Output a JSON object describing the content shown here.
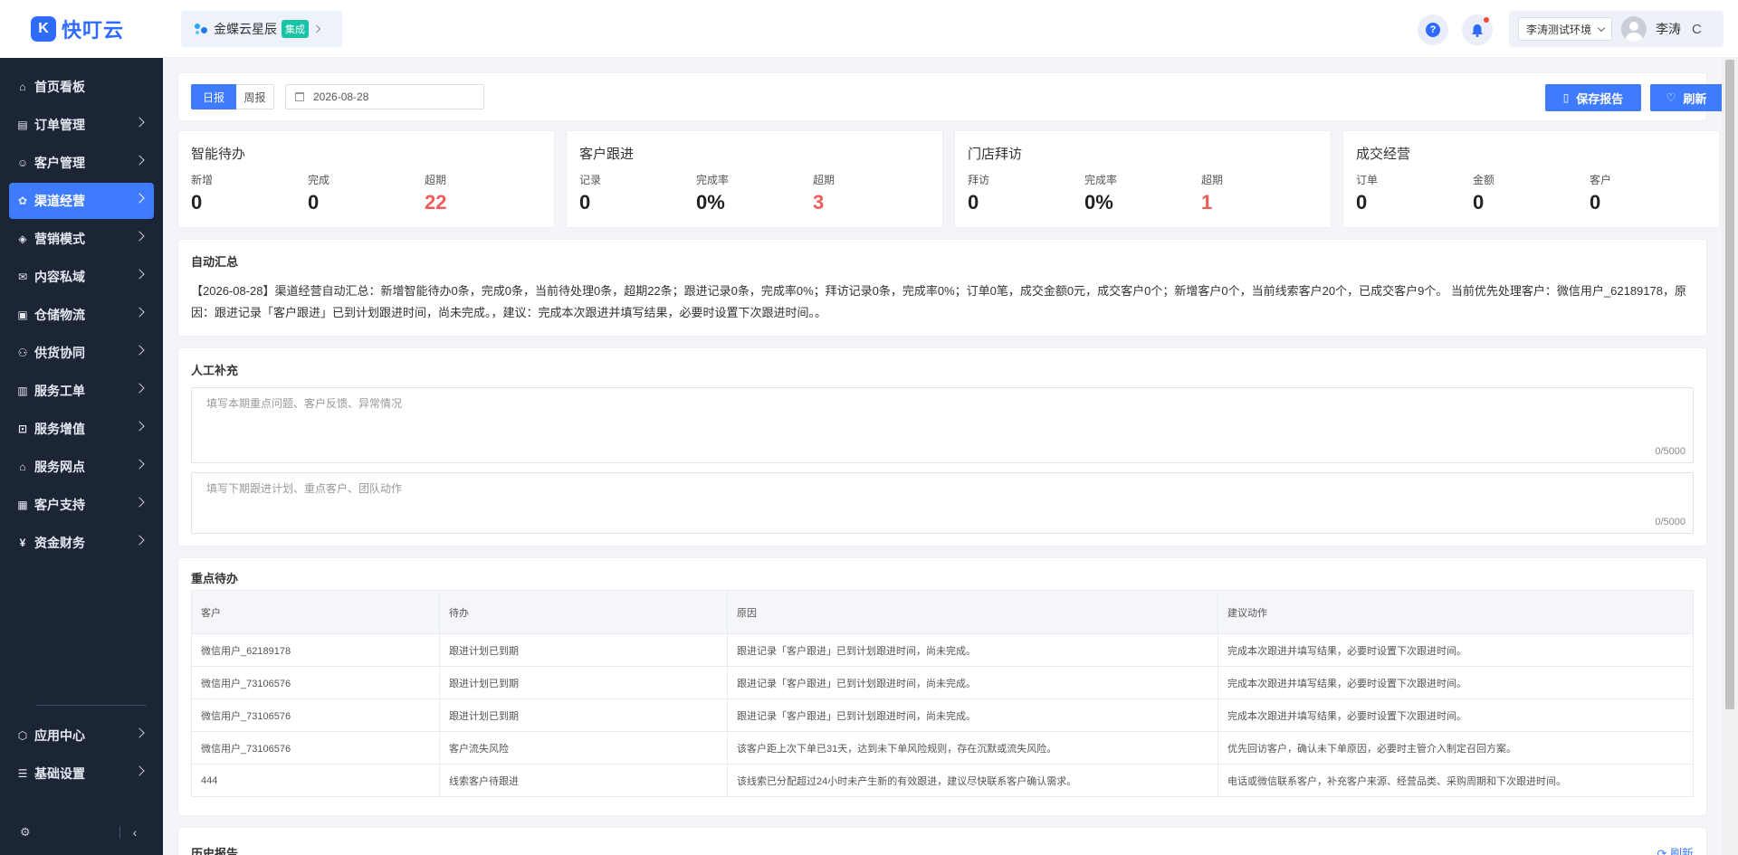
{
  "app": {
    "logo_text": "快叮云",
    "logo_mark": "K"
  },
  "sidebar": {
    "items": [
      {
        "label": "首页看板",
        "icon": "home-icon"
      },
      {
        "label": "订单管理",
        "icon": "order-icon"
      },
      {
        "label": "客户管理",
        "icon": "user-icon"
      },
      {
        "label": "渠道经营",
        "icon": "channel-icon"
      },
      {
        "label": "营销模式",
        "icon": "tag-icon"
      },
      {
        "label": "内容私域",
        "icon": "mail-icon"
      },
      {
        "label": "仓储物流",
        "icon": "box-icon"
      },
      {
        "label": "供货协同",
        "icon": "supply-icon"
      },
      {
        "label": "服务工单",
        "icon": "ticket-icon"
      },
      {
        "label": "服务增值",
        "icon": "bag-icon"
      },
      {
        "label": "服务网点",
        "icon": "store-icon"
      },
      {
        "label": "客户支持",
        "icon": "support-icon"
      },
      {
        "label": "资金财务",
        "icon": "yuan-icon"
      }
    ],
    "bottom_items": [
      {
        "label": "应用中心",
        "icon": "app-icon"
      },
      {
        "label": "基础设置",
        "icon": "settings-icon"
      }
    ]
  },
  "header": {
    "integration_name": "金蝶云星辰",
    "integration_badge": "集成",
    "help_glyph": "?",
    "env_label": "李涛测试环境",
    "user_name": "李涛",
    "refresh_glyph": "C"
  },
  "toolbar": {
    "tab_daily": "日报",
    "tab_weekly": "周报",
    "date_value": "2026-08-28",
    "save_label": "保存报告",
    "refresh_label": "刷新"
  },
  "stats": [
    {
      "title": "智能待办",
      "items": [
        {
          "label": "新增",
          "value": "0"
        },
        {
          "label": "完成",
          "value": "0"
        },
        {
          "label": "超期",
          "value": "22"
        }
      ]
    },
    {
      "title": "客户跟进",
      "items": [
        {
          "label": "记录",
          "value": "0"
        },
        {
          "label": "完成率",
          "value": "0%"
        },
        {
          "label": "超期",
          "value": "3"
        }
      ]
    },
    {
      "title": "门店拜访",
      "items": [
        {
          "label": "拜访",
          "value": "0"
        },
        {
          "label": "完成率",
          "value": "0%"
        },
        {
          "label": "超期",
          "value": "1"
        }
      ]
    },
    {
      "title": "成交经营",
      "items": [
        {
          "label": "订单",
          "value": "0"
        },
        {
          "label": "金额",
          "value": "0"
        },
        {
          "label": "客户",
          "value": "0"
        }
      ]
    }
  ],
  "summary": {
    "title": "自动汇总",
    "text": "【2026-08-28】渠道经营自动汇总：新增智能待办0条，完成0条，当前待处理0条，超期22条；跟进记录0条，完成率0%；拜访记录0条，完成率0%；订单0笔，成交金额0元，成交客户0个；新增客户0个，当前线索客户20个，已成交客户9个。 当前优先处理客户：微信用户_62189178，原因：跟进记录「客户跟进」已到计划跟进时间，尚未完成。，建议：完成本次跟进并填写结果，必要时设置下次跟进时间。。"
  },
  "manual": {
    "title": "人工补充",
    "field1_placeholder": "填写本期重点问题、客户反馈、异常情况",
    "field1_count": "0/5000",
    "field2_placeholder": "填写下期跟进计划、重点客户、团队动作",
    "field2_count": "0/5000"
  },
  "todo": {
    "title": "重点待办",
    "columns": [
      "客户",
      "待办",
      "原因",
      "建议动作"
    ],
    "rows": [
      [
        "微信用户_62189178",
        "跟进计划已到期",
        "跟进记录「客户跟进」已到计划跟进时间，尚未完成。",
        "完成本次跟进并填写结果，必要时设置下次跟进时间。"
      ],
      [
        "微信用户_73106576",
        "跟进计划已到期",
        "跟进记录「客户跟进」已到计划跟进时间，尚未完成。",
        "完成本次跟进并填写结果，必要时设置下次跟进时间。"
      ],
      [
        "微信用户_73106576",
        "跟进计划已到期",
        "跟进记录「客户跟进」已到计划跟进时间，尚未完成。",
        "完成本次跟进并填写结果，必要时设置下次跟进时间。"
      ],
      [
        "微信用户_73106576",
        "客户流失风险",
        "该客户距上次下单已31天，达到未下单风险规则，存在沉默或流失风险。",
        "优先回访客户，确认未下单原因，必要时主管介入制定召回方案。"
      ],
      [
        "444",
        "线索客户待跟进",
        "该线索已分配超过24小时未产生新的有效跟进，建议尽快联系客户确认需求。",
        "电话或微信联系客户，补充客户来源、经营品类、采购周期和下次跟进时间。"
      ]
    ]
  },
  "history": {
    "title": "历史报告",
    "refresh_label": "刷新"
  },
  "colors": {
    "accent": "#3e7bff",
    "sidebar_bg": "#1c2536",
    "danger": "#ef5b5b",
    "badge": "#19c3a6"
  }
}
